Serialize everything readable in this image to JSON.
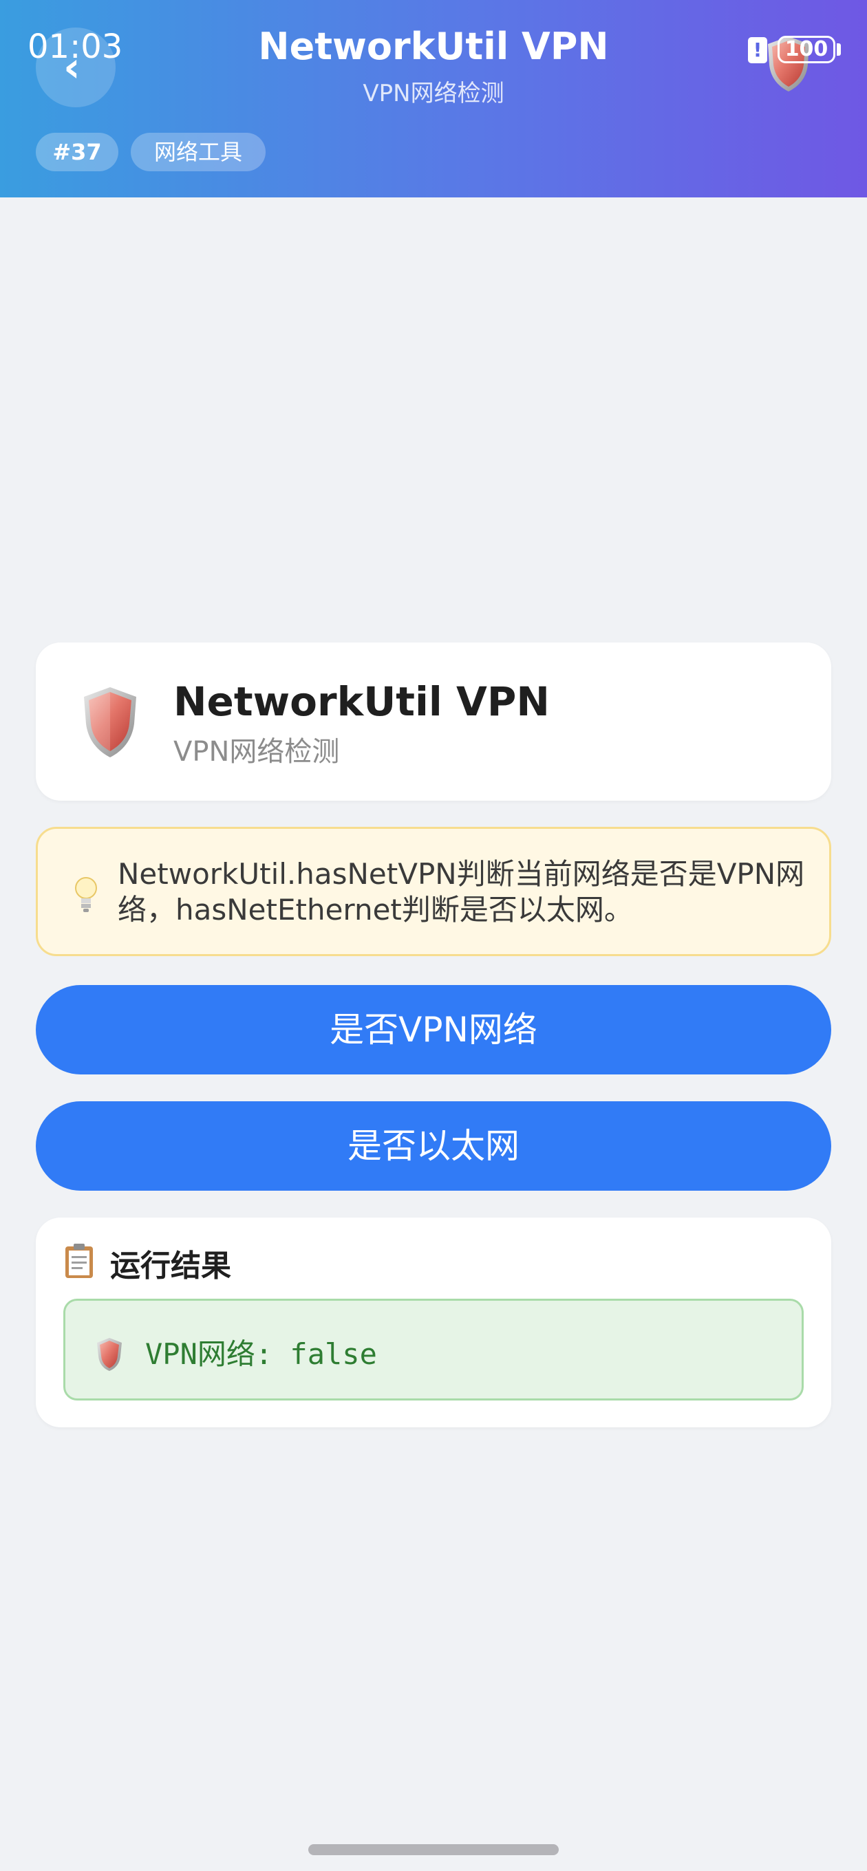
{
  "status_bar": {
    "time": "01:03",
    "battery_alert": "!",
    "battery_level": "100"
  },
  "header": {
    "title": "NetworkUtil VPN",
    "subtitle": "VPN网络检测",
    "back_icon": "chevron-left-icon",
    "tags": {
      "id": "#37",
      "category": "网络工具"
    },
    "gradient_start": "#3a9de0",
    "gradient_end": "#6f58e4"
  },
  "info_card": {
    "icon": "shield-icon",
    "title": "NetworkUtil VPN",
    "subtitle": "VPN网络检测"
  },
  "tip": {
    "icon": "lightbulb-icon",
    "text": "NetworkUtil.hasNetVPN判断当前网络是否是VPN网络，hasNetEthernet判断是否以太网。"
  },
  "buttons": {
    "vpn_label": "是否VPN网络",
    "ethernet_label": "是否以太网",
    "color": "#317bf6"
  },
  "result": {
    "icon": "clipboard-icon",
    "title": "运行结果",
    "output_icon": "shield-icon",
    "output_text": "VPN网络: false",
    "output_color": "#2e7d32"
  }
}
